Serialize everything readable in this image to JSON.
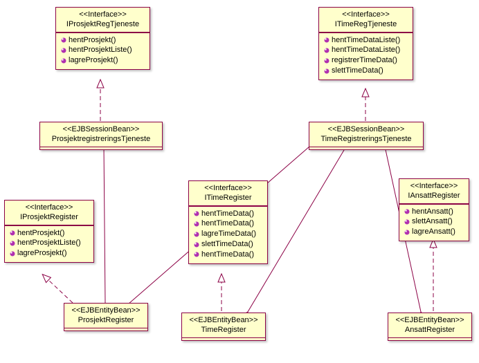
{
  "iface_label": "<<Interface>>",
  "sess_label": "<<EJBSessionBean>>",
  "ent_label": "<<EJBEntityBean>>",
  "c1": {
    "name": "IProsjektRegTjeneste",
    "ops": [
      "hentProsjekt()",
      "hentProsjektListe()",
      "lagreProsjekt()"
    ]
  },
  "c2": {
    "name": "ITimeRegTjeneste",
    "ops": [
      "hentTimeDataListe()",
      "hentTimeDataListe()",
      "registrerTimeData()",
      "slettTimeData()"
    ]
  },
  "c3": {
    "name": "ProsjektregistreringsTjeneste"
  },
  "c4": {
    "name": "TimeRegistreringsTjeneste"
  },
  "c5": {
    "name": "IProsjektRegister",
    "ops": [
      "hentProsjekt()",
      "hentProsjektListe()",
      "lagreProsjekt()"
    ]
  },
  "c6": {
    "name": "ITimeRegister",
    "ops": [
      "hentTimeData()",
      "hentTimeData()",
      "lagreTimeData()",
      "slettTimeData()",
      "hentTimeData()"
    ]
  },
  "c7": {
    "name": "IAnsattRegister",
    "ops": [
      "hentAnsatt()",
      "slettAnsatt()",
      "lagreAnsatt()"
    ]
  },
  "c8": {
    "name": "ProsjektRegister"
  },
  "c9": {
    "name": "TimeRegister"
  },
  "c10": {
    "name": "AnsattRegister"
  }
}
